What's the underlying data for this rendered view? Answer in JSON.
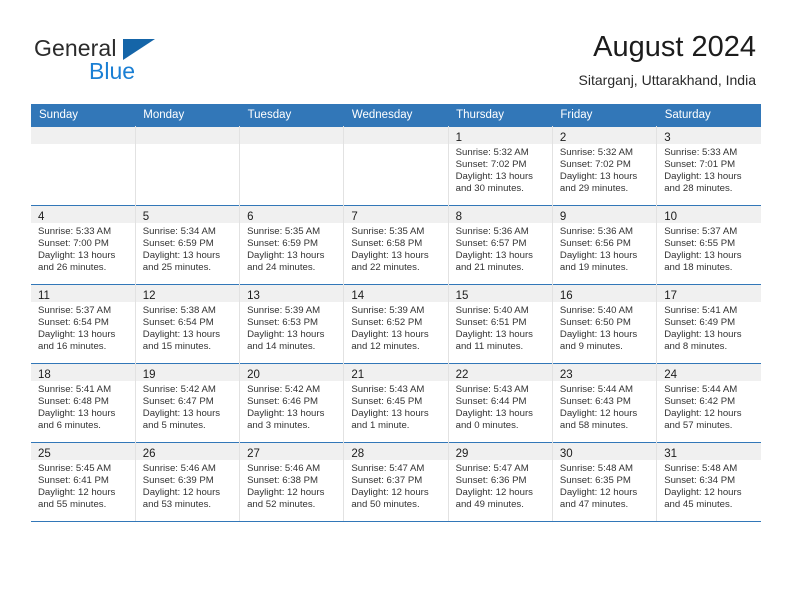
{
  "brand": {
    "name_top": "General",
    "name_bottom": "Blue",
    "triangle_color": "#1565a8",
    "blue_color": "#1a7fd4"
  },
  "header": {
    "title": "August 2024",
    "subtitle": "Sitarganj, Uttarakhand, India"
  },
  "theme": {
    "header_blue": "#3277b8",
    "daynum_bg": "#f0f0f0",
    "text": "#333333"
  },
  "weekdays": [
    "Sunday",
    "Monday",
    "Tuesday",
    "Wednesday",
    "Thursday",
    "Friday",
    "Saturday"
  ],
  "weeks": [
    [
      {
        "day": "",
        "line1": "",
        "line2": "",
        "line3": "",
        "line4": ""
      },
      {
        "day": "",
        "line1": "",
        "line2": "",
        "line3": "",
        "line4": ""
      },
      {
        "day": "",
        "line1": "",
        "line2": "",
        "line3": "",
        "line4": ""
      },
      {
        "day": "",
        "line1": "",
        "line2": "",
        "line3": "",
        "line4": ""
      },
      {
        "day": "1",
        "line1": "Sunrise: 5:32 AM",
        "line2": "Sunset: 7:02 PM",
        "line3": "Daylight: 13 hours",
        "line4": "and 30 minutes."
      },
      {
        "day": "2",
        "line1": "Sunrise: 5:32 AM",
        "line2": "Sunset: 7:02 PM",
        "line3": "Daylight: 13 hours",
        "line4": "and 29 minutes."
      },
      {
        "day": "3",
        "line1": "Sunrise: 5:33 AM",
        "line2": "Sunset: 7:01 PM",
        "line3": "Daylight: 13 hours",
        "line4": "and 28 minutes."
      }
    ],
    [
      {
        "day": "4",
        "line1": "Sunrise: 5:33 AM",
        "line2": "Sunset: 7:00 PM",
        "line3": "Daylight: 13 hours",
        "line4": "and 26 minutes."
      },
      {
        "day": "5",
        "line1": "Sunrise: 5:34 AM",
        "line2": "Sunset: 6:59 PM",
        "line3": "Daylight: 13 hours",
        "line4": "and 25 minutes."
      },
      {
        "day": "6",
        "line1": "Sunrise: 5:35 AM",
        "line2": "Sunset: 6:59 PM",
        "line3": "Daylight: 13 hours",
        "line4": "and 24 minutes."
      },
      {
        "day": "7",
        "line1": "Sunrise: 5:35 AM",
        "line2": "Sunset: 6:58 PM",
        "line3": "Daylight: 13 hours",
        "line4": "and 22 minutes."
      },
      {
        "day": "8",
        "line1": "Sunrise: 5:36 AM",
        "line2": "Sunset: 6:57 PM",
        "line3": "Daylight: 13 hours",
        "line4": "and 21 minutes."
      },
      {
        "day": "9",
        "line1": "Sunrise: 5:36 AM",
        "line2": "Sunset: 6:56 PM",
        "line3": "Daylight: 13 hours",
        "line4": "and 19 minutes."
      },
      {
        "day": "10",
        "line1": "Sunrise: 5:37 AM",
        "line2": "Sunset: 6:55 PM",
        "line3": "Daylight: 13 hours",
        "line4": "and 18 minutes."
      }
    ],
    [
      {
        "day": "11",
        "line1": "Sunrise: 5:37 AM",
        "line2": "Sunset: 6:54 PM",
        "line3": "Daylight: 13 hours",
        "line4": "and 16 minutes."
      },
      {
        "day": "12",
        "line1": "Sunrise: 5:38 AM",
        "line2": "Sunset: 6:54 PM",
        "line3": "Daylight: 13 hours",
        "line4": "and 15 minutes."
      },
      {
        "day": "13",
        "line1": "Sunrise: 5:39 AM",
        "line2": "Sunset: 6:53 PM",
        "line3": "Daylight: 13 hours",
        "line4": "and 14 minutes."
      },
      {
        "day": "14",
        "line1": "Sunrise: 5:39 AM",
        "line2": "Sunset: 6:52 PM",
        "line3": "Daylight: 13 hours",
        "line4": "and 12 minutes."
      },
      {
        "day": "15",
        "line1": "Sunrise: 5:40 AM",
        "line2": "Sunset: 6:51 PM",
        "line3": "Daylight: 13 hours",
        "line4": "and 11 minutes."
      },
      {
        "day": "16",
        "line1": "Sunrise: 5:40 AM",
        "line2": "Sunset: 6:50 PM",
        "line3": "Daylight: 13 hours",
        "line4": "and 9 minutes."
      },
      {
        "day": "17",
        "line1": "Sunrise: 5:41 AM",
        "line2": "Sunset: 6:49 PM",
        "line3": "Daylight: 13 hours",
        "line4": "and 8 minutes."
      }
    ],
    [
      {
        "day": "18",
        "line1": "Sunrise: 5:41 AM",
        "line2": "Sunset: 6:48 PM",
        "line3": "Daylight: 13 hours",
        "line4": "and 6 minutes."
      },
      {
        "day": "19",
        "line1": "Sunrise: 5:42 AM",
        "line2": "Sunset: 6:47 PM",
        "line3": "Daylight: 13 hours",
        "line4": "and 5 minutes."
      },
      {
        "day": "20",
        "line1": "Sunrise: 5:42 AM",
        "line2": "Sunset: 6:46 PM",
        "line3": "Daylight: 13 hours",
        "line4": "and 3 minutes."
      },
      {
        "day": "21",
        "line1": "Sunrise: 5:43 AM",
        "line2": "Sunset: 6:45 PM",
        "line3": "Daylight: 13 hours",
        "line4": "and 1 minute."
      },
      {
        "day": "22",
        "line1": "Sunrise: 5:43 AM",
        "line2": "Sunset: 6:44 PM",
        "line3": "Daylight: 13 hours",
        "line4": "and 0 minutes."
      },
      {
        "day": "23",
        "line1": "Sunrise: 5:44 AM",
        "line2": "Sunset: 6:43 PM",
        "line3": "Daylight: 12 hours",
        "line4": "and 58 minutes."
      },
      {
        "day": "24",
        "line1": "Sunrise: 5:44 AM",
        "line2": "Sunset: 6:42 PM",
        "line3": "Daylight: 12 hours",
        "line4": "and 57 minutes."
      }
    ],
    [
      {
        "day": "25",
        "line1": "Sunrise: 5:45 AM",
        "line2": "Sunset: 6:41 PM",
        "line3": "Daylight: 12 hours",
        "line4": "and 55 minutes."
      },
      {
        "day": "26",
        "line1": "Sunrise: 5:46 AM",
        "line2": "Sunset: 6:39 PM",
        "line3": "Daylight: 12 hours",
        "line4": "and 53 minutes."
      },
      {
        "day": "27",
        "line1": "Sunrise: 5:46 AM",
        "line2": "Sunset: 6:38 PM",
        "line3": "Daylight: 12 hours",
        "line4": "and 52 minutes."
      },
      {
        "day": "28",
        "line1": "Sunrise: 5:47 AM",
        "line2": "Sunset: 6:37 PM",
        "line3": "Daylight: 12 hours",
        "line4": "and 50 minutes."
      },
      {
        "day": "29",
        "line1": "Sunrise: 5:47 AM",
        "line2": "Sunset: 6:36 PM",
        "line3": "Daylight: 12 hours",
        "line4": "and 49 minutes."
      },
      {
        "day": "30",
        "line1": "Sunrise: 5:48 AM",
        "line2": "Sunset: 6:35 PM",
        "line3": "Daylight: 12 hours",
        "line4": "and 47 minutes."
      },
      {
        "day": "31",
        "line1": "Sunrise: 5:48 AM",
        "line2": "Sunset: 6:34 PM",
        "line3": "Daylight: 12 hours",
        "line4": "and 45 minutes."
      }
    ]
  ]
}
